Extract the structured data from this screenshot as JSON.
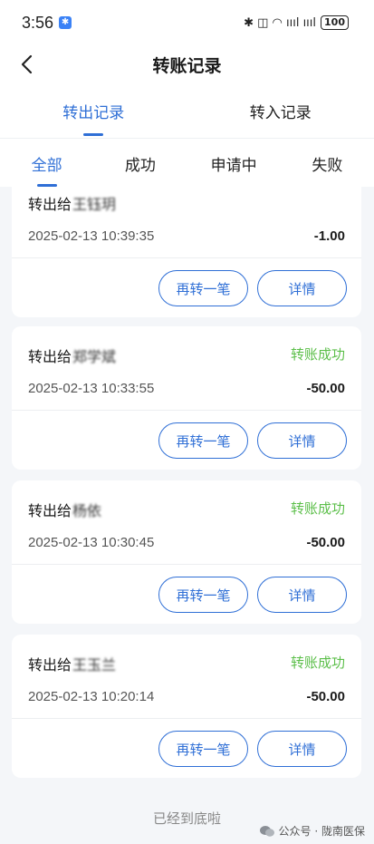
{
  "status_bar": {
    "time": "3:56",
    "notification_badge": "✱",
    "right_icons": "✱ ◫ ◠ ıııl ıııl",
    "battery": "100"
  },
  "nav": {
    "title": "转账记录"
  },
  "main_tabs": [
    {
      "label": "转出记录",
      "active": true
    },
    {
      "label": "转入记录",
      "active": false
    }
  ],
  "sub_tabs": [
    {
      "label": "全部",
      "active": true
    },
    {
      "label": "成功",
      "active": false
    },
    {
      "label": "申请中",
      "active": false
    },
    {
      "label": "失败",
      "active": false
    }
  ],
  "records": [
    {
      "name_prefix": "转出给",
      "name_obscured": "王钰玥",
      "status": "",
      "time": "2025-02-13 10:39:35",
      "amount": "-1.00",
      "btn_again": "再转一笔",
      "btn_detail": "详情"
    },
    {
      "name_prefix": "转出给",
      "name_obscured": "郑学斌",
      "status": "转账成功",
      "time": "2025-02-13 10:33:55",
      "amount": "-50.00",
      "btn_again": "再转一笔",
      "btn_detail": "详情"
    },
    {
      "name_prefix": "转出给",
      "name_obscured": "杨依",
      "status": "转账成功",
      "time": "2025-02-13 10:30:45",
      "amount": "-50.00",
      "btn_again": "再转一笔",
      "btn_detail": "详情"
    },
    {
      "name_prefix": "转出给",
      "name_obscured": "王玉兰",
      "status": "转账成功",
      "time": "2025-02-13 10:20:14",
      "amount": "-50.00",
      "btn_again": "再转一笔",
      "btn_detail": "详情"
    }
  ],
  "footer_note": "已经到底啦",
  "watermark": "公众号 · 陇南医保",
  "colors": {
    "accent": "#2f6fd6",
    "success": "#5cbf4a",
    "background": "#f4f6f9"
  }
}
